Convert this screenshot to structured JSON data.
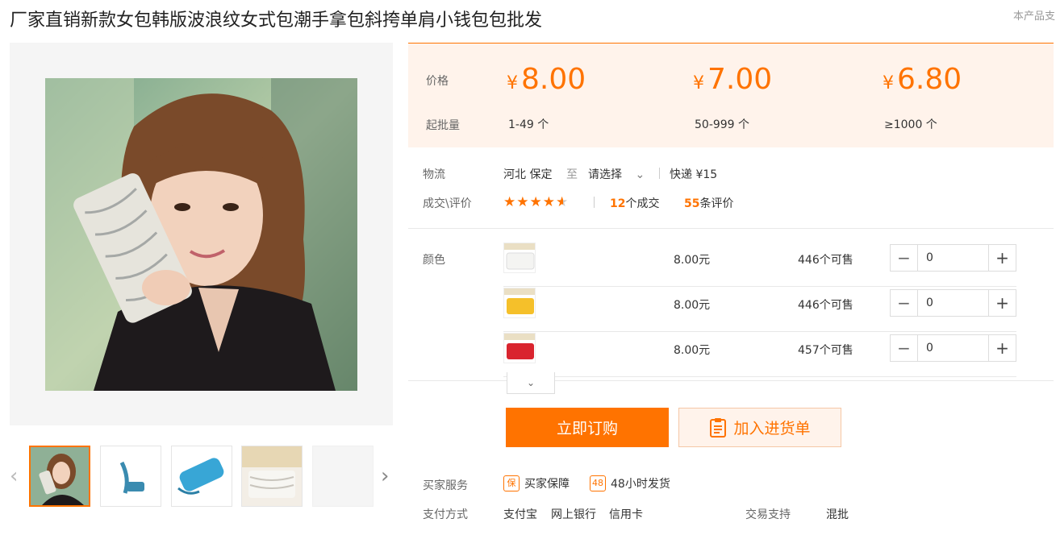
{
  "product": {
    "title": "厂家直销新款女包韩版波浪纹女式包潮手拿包斜挎单肩小钱包包批发",
    "corner_note": "本产品支"
  },
  "price_table": {
    "price_label": "价格",
    "moq_label": "起批量",
    "currency": "¥",
    "tiers": [
      {
        "price": "8.00",
        "range": "1-49 个"
      },
      {
        "price": "7.00",
        "range": "50-999 个"
      },
      {
        "price": "6.80",
        "range": "≥1000 个"
      }
    ]
  },
  "logistics": {
    "label": "物流",
    "from": "河北 保定",
    "to_word": "至",
    "select_text": "请选择",
    "shipping": "快递 ¥15"
  },
  "trade": {
    "label": "成交\\评价",
    "rating": 4.5,
    "deals_count": "12",
    "deals_suffix": "个成交",
    "reviews_count": "55",
    "reviews_suffix": "条评价"
  },
  "sku": {
    "label": "颜色",
    "rows": [
      {
        "color": "#f4f4f2",
        "price": "8.00元",
        "stock": "446个可售",
        "qty": "0"
      },
      {
        "color": "#f5c02a",
        "price": "8.00元",
        "stock": "446个可售",
        "qty": "0"
      },
      {
        "color": "#d9242e",
        "price": "8.00元",
        "stock": "457个可售",
        "qty": "0"
      }
    ]
  },
  "actions": {
    "buy_now": "立即订购",
    "add_to_cart": "加入进货单"
  },
  "services": {
    "label": "买家服务",
    "items": [
      "买家保障",
      "48小时发货"
    ],
    "icons": [
      "保",
      "48"
    ]
  },
  "payment": {
    "label": "支付方式",
    "methods": [
      "支付宝",
      "网上银行",
      "信用卡"
    ],
    "trade_support_label": "交易支持",
    "trade_support_value": "混批"
  },
  "colors": {
    "accent": "#ff7300",
    "price_bg": "#fff3eb"
  }
}
